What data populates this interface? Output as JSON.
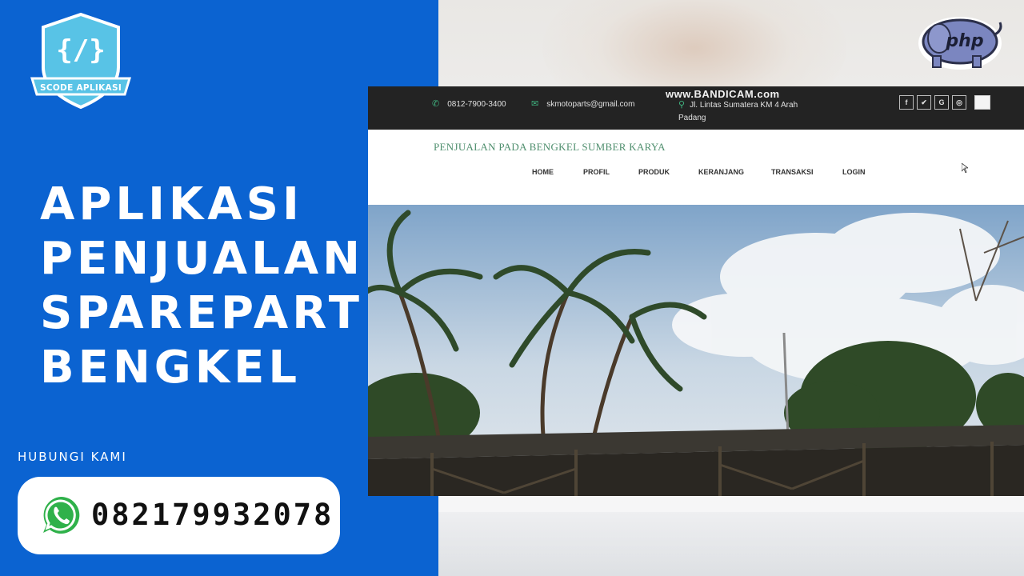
{
  "brand_badge": {
    "text": "SCODE APLIKASI",
    "icon": "code-braces-icon",
    "color": "#58c3e6"
  },
  "headline": [
    "APLIKASI",
    "PENJUALAN",
    "SPAREPART",
    "BENGKEL"
  ],
  "contact": {
    "label": "HUBUNGI KAMI",
    "phone": "082179932078",
    "icon": "whatsapp-icon"
  },
  "php_logo": {
    "text": "php",
    "icon": "php-elephant-icon"
  },
  "website": {
    "topbar": {
      "phone": "0812-7900-3400",
      "email": "skmotoparts@gmail.com",
      "address": "Jl. Lintas Sumatera KM 4 Arah Padang",
      "watermark": "www.BANDICAM.com",
      "social_icons": [
        "facebook-icon",
        "twitter-icon",
        "google-icon",
        "instagram-icon"
      ]
    },
    "brand_title": "PENJUALAN PADA BENGKEL SUMBER KARYA",
    "nav": [
      "HOME",
      "PROFIL",
      "PRODUK",
      "KERANJANG",
      "TRANSAKSI",
      "LOGIN"
    ]
  },
  "colors": {
    "panel_blue": "#0b63d1",
    "topbar_dark": "#232323",
    "brand_green": "#4f8f6e"
  }
}
